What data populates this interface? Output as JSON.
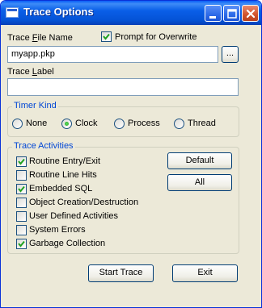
{
  "window": {
    "title": "Trace Options"
  },
  "trace_file": {
    "label_pre": "Trace ",
    "label_accel": "F",
    "label_post": "ile Name",
    "value": "myapp.pkp",
    "browse_label": "..."
  },
  "prompt_overwrite": {
    "label": "Prompt for Overwrite",
    "checked": true
  },
  "trace_label": {
    "label_pre": "Trace ",
    "label_accel": "L",
    "label_post": "abel",
    "value": ""
  },
  "timer_kind": {
    "title": "Timer Kind",
    "options": [
      {
        "label": "None",
        "selected": false
      },
      {
        "label": "Clock",
        "selected": true
      },
      {
        "label": "Process",
        "selected": false
      },
      {
        "label": "Thread",
        "selected": false
      }
    ]
  },
  "trace_activities": {
    "title": "Trace Activities",
    "items": [
      {
        "label": "Routine Entry/Exit",
        "checked": true
      },
      {
        "label": "Routine Line Hits",
        "checked": false
      },
      {
        "label": "Embedded SQL",
        "checked": true
      },
      {
        "label": "Object Creation/Destruction",
        "checked": false
      },
      {
        "label": "User Defined Activities",
        "checked": false
      },
      {
        "label": "System Errors",
        "checked": false
      },
      {
        "label": "Garbage Collection",
        "checked": true
      }
    ],
    "default_label": "Default",
    "all_label": "All"
  },
  "actions": {
    "start_label": "Start Trace",
    "exit_label": "Exit"
  },
  "colors": {
    "titlebar": "#0453d6",
    "face": "#ece9d8",
    "group_title": "#0046d5"
  }
}
